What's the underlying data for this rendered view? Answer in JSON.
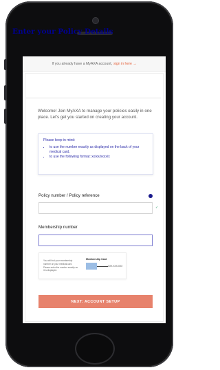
{
  "topbar": {
    "text": "If you already have a MyAXA account,",
    "link": "sign in here →"
  },
  "form": {
    "title": "Enter your Policy Details",
    "intro": "Welcome! Join MyAXA to manage your policies easily in one place. Let's get you started on creating your account.",
    "notice": {
      "title": "Please keep in mind:",
      "bullets": [
        "to use the number exactly as displayed on the back of your medical card.",
        "to use the following format: xx/xx/xxxx/x"
      ]
    },
    "policy_label": "Policy number / Policy reference",
    "policy_value": "",
    "policy_check": "✓",
    "membership_label": "Membership number",
    "membership_value": "",
    "card_hint": {
      "text": "You will find your membership number on your medical card. Please enter the number exactly as it is displayed.",
      "card_title": "Membership Card",
      "card_number": "XXX-XXX-XXX"
    },
    "cta_label": "NEXT: ACCOUNT SETUP"
  },
  "colors": {
    "brand_blue": "#00008f",
    "link_orange": "#e4603a",
    "cta": "#e7826c"
  }
}
